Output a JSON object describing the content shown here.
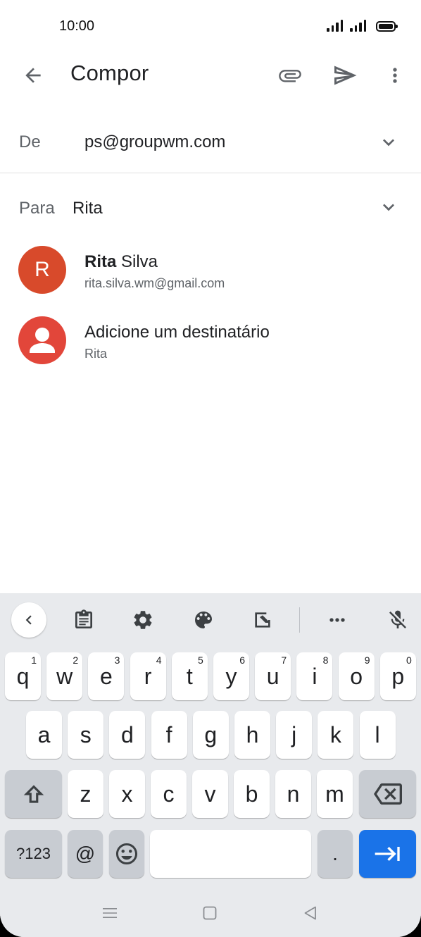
{
  "status_bar": {
    "time": "10:00"
  },
  "app_bar": {
    "title": "Compor",
    "back_icon": "arrow-left-icon",
    "attach_icon": "paperclip-icon",
    "send_icon": "send-icon",
    "more_icon": "more-vert-icon"
  },
  "from": {
    "label": "De",
    "value": "ps@groupwm.com"
  },
  "to": {
    "label": "Para",
    "value": "Rita"
  },
  "suggestions": [
    {
      "avatar_letter": "R",
      "name_bold": "Rita",
      "name_rest": " Silva",
      "email": "rita.silva.wm@gmail.com",
      "color": "#d84a2b"
    },
    {
      "title": "Adicione um destinatário",
      "sub": "Rita",
      "color": "#e2463a"
    }
  ],
  "keyboard": {
    "row1": [
      {
        "k": "q",
        "h": "1"
      },
      {
        "k": "w",
        "h": "2"
      },
      {
        "k": "e",
        "h": "3"
      },
      {
        "k": "r",
        "h": "4"
      },
      {
        "k": "t",
        "h": "5"
      },
      {
        "k": "y",
        "h": "6"
      },
      {
        "k": "u",
        "h": "7"
      },
      {
        "k": "i",
        "h": "8"
      },
      {
        "k": "o",
        "h": "9"
      },
      {
        "k": "p",
        "h": "0"
      }
    ],
    "row2": [
      "a",
      "s",
      "d",
      "f",
      "g",
      "h",
      "j",
      "k",
      "l"
    ],
    "row3": [
      "z",
      "x",
      "c",
      "v",
      "b",
      "n",
      "m"
    ],
    "symbols_label": "?123",
    "at_label": "@",
    "period_label": ".",
    "accent_color": "#1a73e8"
  }
}
